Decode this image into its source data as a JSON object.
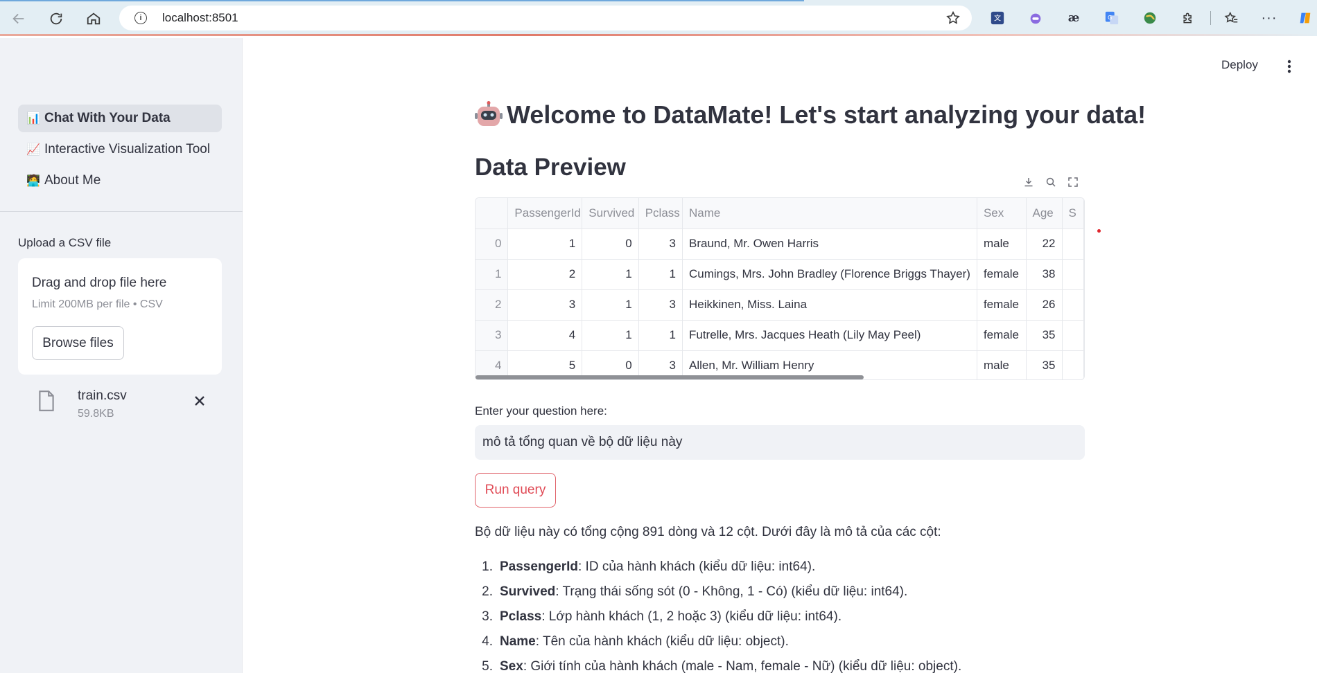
{
  "browser": {
    "url": "localhost:8501",
    "extensions": [
      "translate-extension-icon",
      "purple-extension-icon",
      "ae-extension-icon",
      "google-translate-icon",
      "globe-extension-icon",
      "puzzle-icon",
      "favorites-icon",
      "more-icon",
      "copilot-icon"
    ]
  },
  "sidebar": {
    "nav": [
      {
        "emoji": "📊",
        "label": "Chat With Your Data",
        "active": true
      },
      {
        "emoji": "📈",
        "label": "Interactive Visualization Tool",
        "active": false
      },
      {
        "emoji": "🧑‍💻",
        "label": "About Me",
        "active": false
      }
    ],
    "upload_label": "Upload a CSV file",
    "dropzone_title": "Drag and drop file here",
    "dropzone_limit": "Limit 200MB per file • CSV",
    "browse_label": "Browse files",
    "file": {
      "name": "train.csv",
      "size": "59.8KB"
    }
  },
  "header": {
    "deploy_label": "Deploy"
  },
  "main": {
    "title": "Welcome to DataMate! Let's start analyzing your data!",
    "preview_heading": "Data Preview",
    "table": {
      "columns": [
        "",
        "PassengerId",
        "Survived",
        "Pclass",
        "Name",
        "Sex",
        "Age",
        "S"
      ],
      "rows": [
        [
          "0",
          "1",
          "0",
          "3",
          "Braund, Mr. Owen Harris",
          "male",
          "22",
          ""
        ],
        [
          "1",
          "2",
          "1",
          "1",
          "Cumings, Mrs. John Bradley (Florence Briggs Thayer)",
          "female",
          "38",
          ""
        ],
        [
          "2",
          "3",
          "1",
          "3",
          "Heikkinen, Miss. Laina",
          "female",
          "26",
          ""
        ],
        [
          "3",
          "4",
          "1",
          "1",
          "Futrelle, Mrs. Jacques Heath (Lily May Peel)",
          "female",
          "35",
          ""
        ],
        [
          "4",
          "5",
          "0",
          "3",
          "Allen, Mr. William Henry",
          "male",
          "35",
          ""
        ]
      ]
    },
    "question_label": "Enter your question here:",
    "question_value": "mô tả tổng quan về bộ dữ liệu này",
    "run_label": "Run query",
    "answer_intro": "Bộ dữ liệu này có tổng cộng 891 dòng và 12 cột. Dưới đây là mô tả của các cột:",
    "answer_items": [
      {
        "n": "1.",
        "term": "PassengerId",
        "desc": ": ID của hành khách (kiểu dữ liệu: int64)."
      },
      {
        "n": "2.",
        "term": "Survived",
        "desc": ": Trạng thái sống sót (0 - Không, 1 - Có) (kiểu dữ liệu: int64)."
      },
      {
        "n": "3.",
        "term": "Pclass",
        "desc": ": Lớp hành khách (1, 2 hoặc 3) (kiểu dữ liệu: int64)."
      },
      {
        "n": "4.",
        "term": "Name",
        "desc": ": Tên của hành khách (kiểu dữ liệu: object)."
      },
      {
        "n": "5.",
        "term": "Sex",
        "desc": ": Giới tính của hành khách (male - Nam, female - Nữ) (kiểu dữ liệu: object)."
      }
    ]
  },
  "colors": {
    "accent": "#ff4b4b",
    "sidebar_bg": "#f0f2f6",
    "text": "#31333f"
  }
}
